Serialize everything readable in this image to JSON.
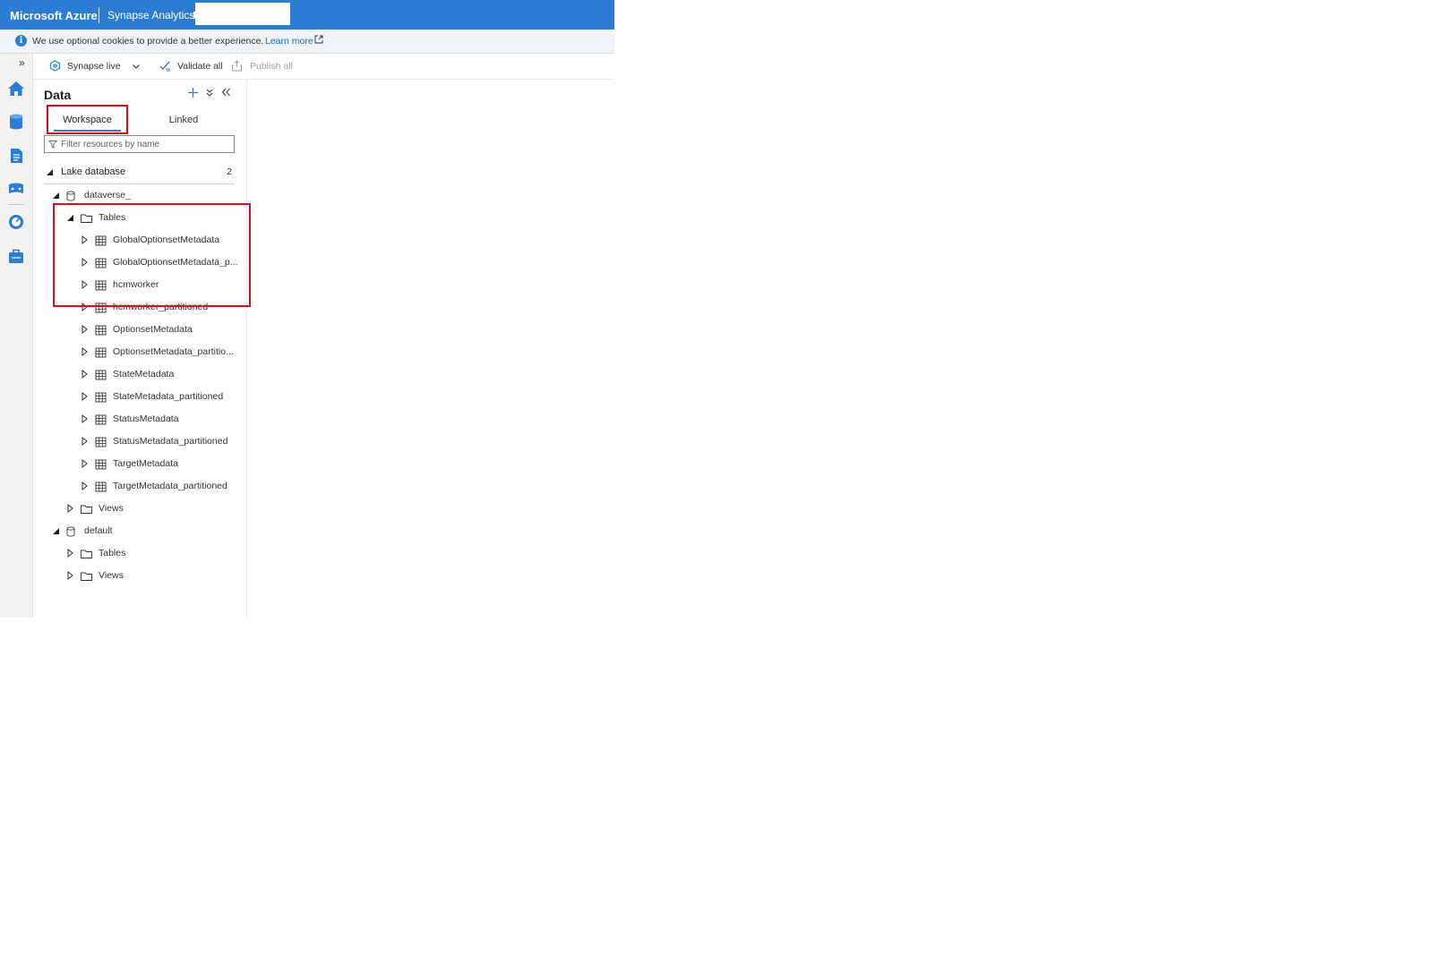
{
  "header": {
    "brand": "Microsoft Azure",
    "service": "Synapse Analytics",
    "colors": {
      "bar": "#2b7cd3",
      "text": "#ffffff"
    }
  },
  "cookie_banner": {
    "message": "We use optional cookies to provide a better experience.",
    "link_label": "Learn more",
    "icon": "info-icon"
  },
  "toolbar": {
    "branch_label": "Synapse live",
    "validate_label": "Validate all",
    "publish_label": "Publish all"
  },
  "rail": {
    "icons": [
      "home-icon",
      "data-icon",
      "develop-icon",
      "integrate-icon",
      "monitor-icon",
      "manage-icon"
    ]
  },
  "data_pane": {
    "title": "Data",
    "tabs": [
      {
        "label": "Workspace",
        "selected": true
      },
      {
        "label": "Linked",
        "selected": false
      }
    ],
    "filter_placeholder": "Filter resources by name",
    "section": {
      "label": "Lake database",
      "count": "2"
    },
    "databases": [
      {
        "name": "dataverse_",
        "folders": [
          {
            "name": "Tables",
            "expanded": true,
            "items": [
              "GlobalOptionsetMetadata",
              "GlobalOptionsetMetadata_p...",
              "hcmworker",
              "hcmworker_partitioned",
              "OptionsetMetadata",
              "OptionsetMetadata_partitio...",
              "StateMetadata",
              "StateMetadata_partitioned",
              "StatusMetadata",
              "StatusMetadata_partitioned",
              "TargetMetadata",
              "TargetMetadata_partitioned"
            ]
          },
          {
            "name": "Views",
            "expanded": false
          }
        ]
      },
      {
        "name": "default",
        "folders": [
          {
            "name": "Tables",
            "expanded": false
          },
          {
            "name": "Views",
            "expanded": false
          }
        ]
      }
    ]
  },
  "annotation_color": "#d1101a"
}
